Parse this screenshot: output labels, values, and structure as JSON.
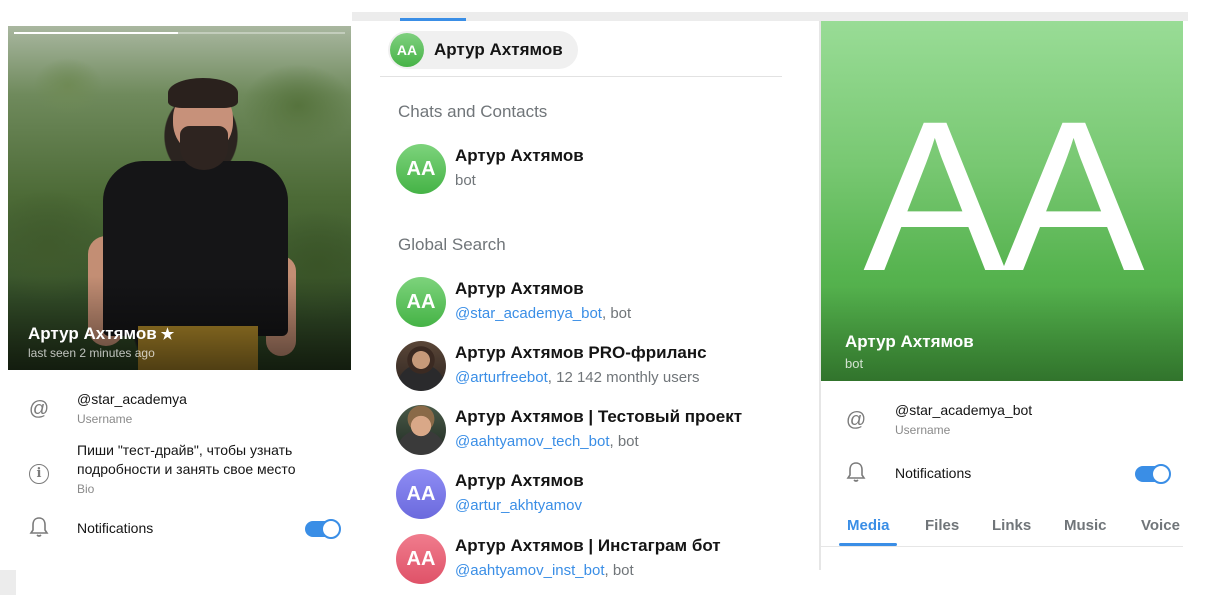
{
  "left_profile": {
    "name": "Артур Ахтямов",
    "star": "★",
    "status": "last seen 2 minutes ago",
    "username": "@star_academya",
    "username_label": "Username",
    "bio": "Пиши \"тест-драйв\", чтобы узнать подробности и занять свое место",
    "bio_label": "Bio",
    "notifications_label": "Notifications",
    "notifications_on": true,
    "icons": {
      "username": "at-icon",
      "bio": "info-icon",
      "notifications": "bell-icon"
    }
  },
  "search": {
    "chip_initials": "AA",
    "chip_label": "Артур Ахтямов",
    "chats_header": "Chats and Contacts",
    "global_header": "Global Search",
    "chats": [
      {
        "initials": "AA",
        "title": "Артур Ахтямов",
        "sub_plain": "bot"
      }
    ],
    "global": [
      {
        "initials": "AA",
        "title": "Артур Ахтямов",
        "link": "@star_academya_bot",
        "rest": ", bot"
      },
      {
        "initials": "",
        "title": "Артур Ахтямов PRO-фриланс",
        "link": "@arturfreebot",
        "rest": ", 12 142 monthly users"
      },
      {
        "initials": "",
        "title": "Артур Ахтямов | Тестовый проект",
        "link": "@aahtyamov_tech_bot",
        "rest": ", bot"
      },
      {
        "initials": "AA",
        "title": "Артур Ахтямов",
        "link": "@artur_akhtyamov",
        "rest": ""
      },
      {
        "initials": "AA",
        "title": "Артур Ахтямов | Инстаграм бот",
        "link": "@aahtyamov_inst_bot",
        "rest": ", bot"
      }
    ]
  },
  "right_profile": {
    "cover_initials": "AA",
    "name": "Артур Ахтямов",
    "sub": "bot",
    "username": "@star_academya_bot",
    "username_label": "Username",
    "notifications_label": "Notifications",
    "notifications_on": true,
    "tabs": [
      "Media",
      "Files",
      "Links",
      "Music",
      "Voice"
    ],
    "active_tab": "Media"
  },
  "colors": {
    "accent": "#3a8ee6",
    "green_avatar": "#45b346",
    "violet_avatar": "#6b6add",
    "red_avatar": "#df5268"
  }
}
